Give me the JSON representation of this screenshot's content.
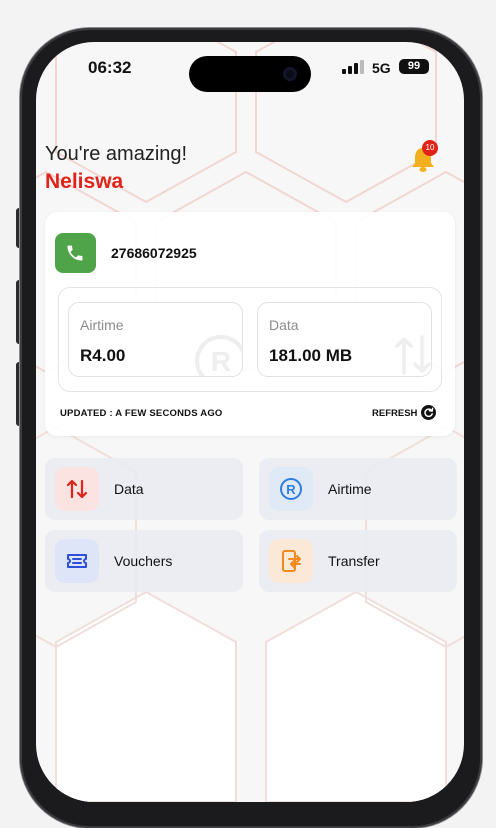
{
  "status_bar": {
    "time": "06:32",
    "network": "5G",
    "battery": "99"
  },
  "header": {
    "greeting": "You're amazing!",
    "user_name": "Neliswa",
    "notification_count": "10"
  },
  "account": {
    "phone_number": "27686072925",
    "balances": [
      {
        "label": "Airtime",
        "value": "R4.00"
      },
      {
        "label": "Data",
        "value": "181.00 MB"
      }
    ],
    "updated_text": "UPDATED : A FEW SECONDS AGO",
    "refresh_label": "REFRESH"
  },
  "actions": [
    {
      "label": "Data",
      "icon": "data-arrows-icon"
    },
    {
      "label": "Airtime",
      "icon": "rand-icon"
    },
    {
      "label": "Vouchers",
      "icon": "voucher-icon"
    },
    {
      "label": "Transfer",
      "icon": "transfer-icon"
    }
  ],
  "colors": {
    "brand_red": "#e0241a",
    "phone_green": "#4fa349",
    "bell_amber": "#f2b01e",
    "airtime_blue": "#2f7de0",
    "voucher_blue": "#2c4fd8",
    "transfer_orange": "#f08a1c"
  }
}
